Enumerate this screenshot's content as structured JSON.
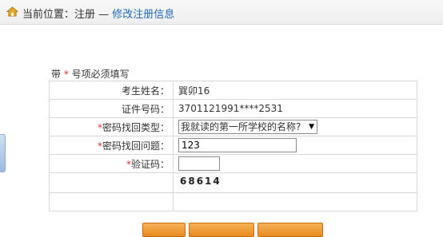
{
  "breadcrumb": {
    "prefix": "当前位置：注册 — ",
    "current": "修改注册信息"
  },
  "form": {
    "required_note_prefix": "带 ",
    "required_star": "*",
    "required_note_suffix": " 号项必须填写",
    "name": {
      "label": "考生姓名：",
      "value": "巽卯16"
    },
    "id_number": {
      "label": "证件号码：",
      "value": "3701121991****2531"
    },
    "recovery_type": {
      "star": "*",
      "label": "密码找回类型：",
      "selected": "我就读的第一所学校的名称?"
    },
    "recovery_question": {
      "star": "*",
      "label": "密码找回问题：",
      "value": "123"
    },
    "captcha": {
      "star": "*",
      "label": "验证码：",
      "value": "",
      "image_text": "68614"
    }
  },
  "buttons": [
    {
      "label": ""
    },
    {
      "label": ""
    },
    {
      "label": ""
    }
  ],
  "colors": {
    "link": "#1e6ab8",
    "required_star": "#e03030",
    "button": "#e88a1c",
    "border": "#d8d8d8"
  }
}
